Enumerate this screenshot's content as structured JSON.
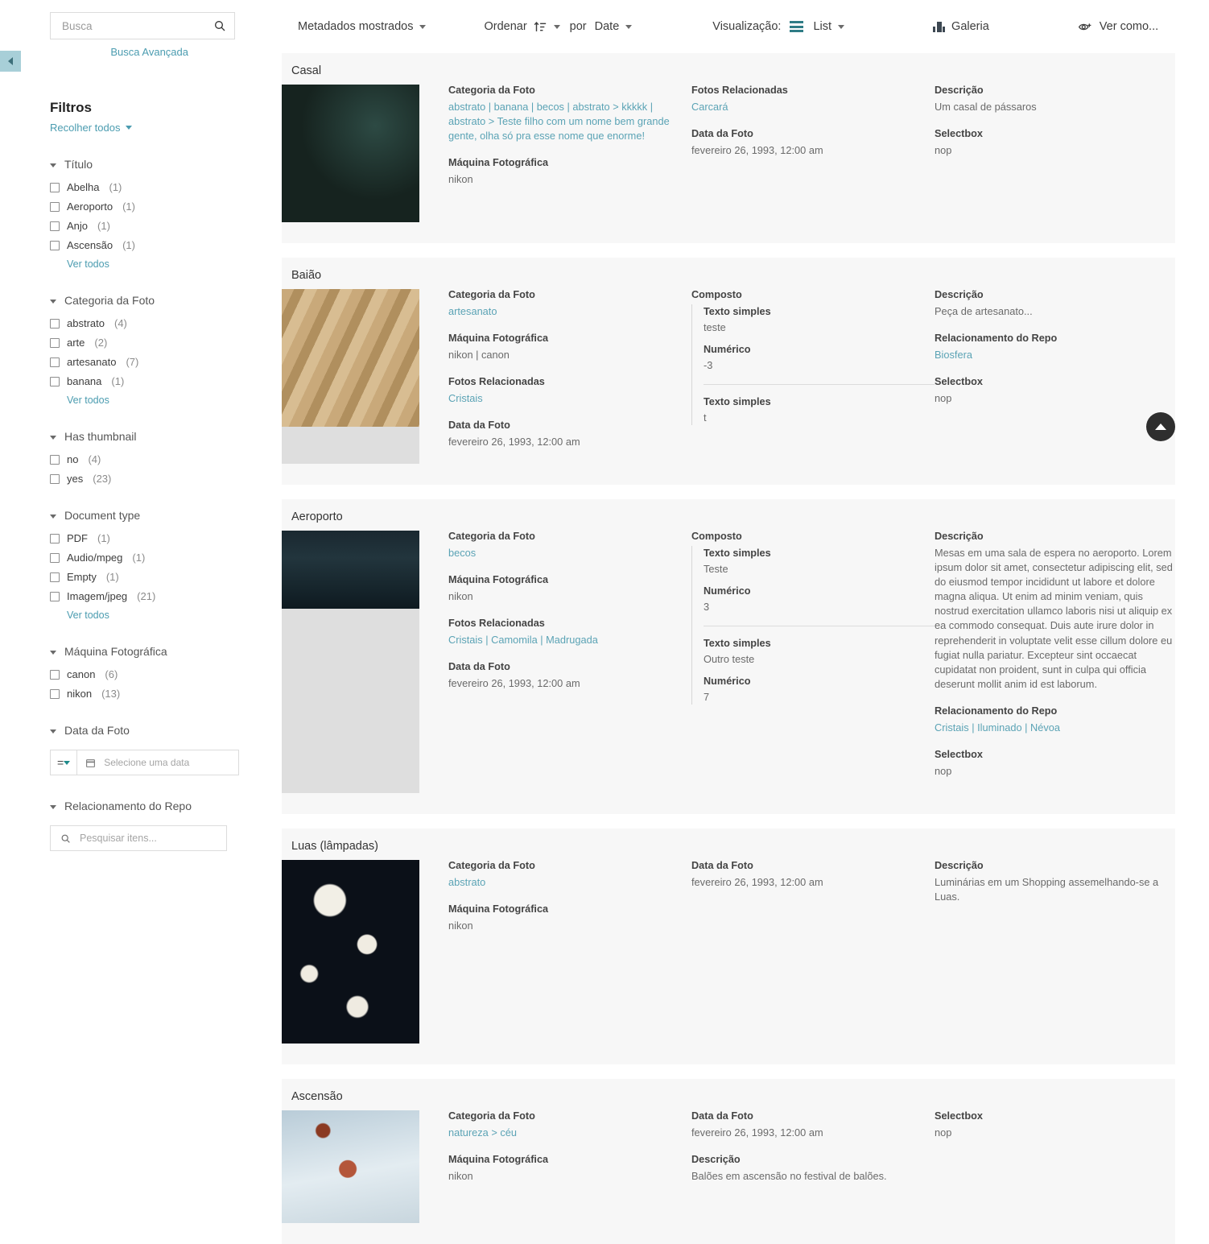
{
  "sidebar": {
    "collapse_handle_icon": "chevron-left-icon",
    "search": {
      "placeholder": "Busca",
      "value": "",
      "icon": "search-icon"
    },
    "advanced_search_label": "Busca Avançada",
    "filters_title": "Filtros",
    "collapse_all_label": "Recolher todos",
    "see_all_label": "Ver todos",
    "facets": [
      {
        "label": "Título",
        "options": [
          {
            "label": "Abelha",
            "count": "(1)"
          },
          {
            "label": "Aeroporto",
            "count": "(1)"
          },
          {
            "label": "Anjo",
            "count": "(1)"
          },
          {
            "label": "Ascensão",
            "count": "(1)"
          }
        ],
        "see_all": true
      },
      {
        "label": "Categoria da Foto",
        "options": [
          {
            "label": "abstrato",
            "count": "(4)"
          },
          {
            "label": "arte",
            "count": "(2)"
          },
          {
            "label": "artesanato",
            "count": "(7)"
          },
          {
            "label": "banana",
            "count": "(1)"
          }
        ],
        "see_all": true
      },
      {
        "label": "Has thumbnail",
        "options": [
          {
            "label": "no",
            "count": "(4)"
          },
          {
            "label": "yes",
            "count": "(23)"
          }
        ],
        "see_all": false
      },
      {
        "label": "Document type",
        "options": [
          {
            "label": "PDF",
            "count": "(1)"
          },
          {
            "label": "Audio/mpeg",
            "count": "(1)"
          },
          {
            "label": "Empty",
            "count": "(1)"
          },
          {
            "label": "Imagem/jpeg",
            "count": "(21)"
          }
        ],
        "see_all": true
      },
      {
        "label": "Máquina Fotográfica",
        "options": [
          {
            "label": "canon",
            "count": "(6)"
          },
          {
            "label": "nikon",
            "count": "(13)"
          }
        ],
        "see_all": false
      }
    ],
    "date_facet": {
      "label": "Data da Foto",
      "operator": "=",
      "date_placeholder": "Selecione uma data",
      "date_value": "",
      "calendar_icon": "calendar-icon"
    },
    "repo_facet": {
      "label": "Relacionamento do Repo",
      "placeholder": "Pesquisar itens...",
      "value": "",
      "icon": "search-icon"
    }
  },
  "toolbar": {
    "metadata_label": "Metadados mostrados",
    "sort_label": "Ordenar",
    "sort_icon": "sort-ascending-icon",
    "by_label": "por",
    "sort_field": "Date",
    "view_label": "Visualização:",
    "view_icon": "list-view-icon",
    "view_mode": "List",
    "gallery_label": "Galeria",
    "gallery_icon": "gallery-icon",
    "view_as_label": "Ver como...",
    "view_as_icon": "eye-plus-icon"
  },
  "scroll_top_icon": "arrow-up-icon",
  "colors": {
    "link": "#5ba3b5",
    "accent_teal": "#1f8a8a",
    "card_bg": "#f7f7f7",
    "handle": "#a8cfd8"
  },
  "cards": [
    {
      "title": "Casal",
      "thumb": "bird-nest-photo",
      "thumb_height": 171,
      "col_a": [
        {
          "type": "text",
          "label": "Categoria da Foto",
          "value": "abstrato | banana | becos | abstrato > kkkkk | abstrato > Teste filho com um nome bem grande gente, olha só pra esse nome que enorme!",
          "link": true
        },
        {
          "type": "text",
          "label": "Máquina Fotográfica",
          "value": "nikon",
          "link": false
        }
      ],
      "col_b": [
        {
          "type": "text",
          "label": "Fotos Relacionadas",
          "value": "Carcará",
          "link": true
        },
        {
          "type": "text",
          "label": "Data da Foto",
          "value": "fevereiro 26, 1993, 12:00 am",
          "link": false
        }
      ],
      "col_c": [
        {
          "type": "text",
          "label": "Descrição",
          "value": "Um casal de pássaros",
          "link": false
        },
        {
          "type": "text",
          "label": "Selectbox",
          "value": "nop",
          "link": false
        }
      ]
    },
    {
      "title": "Baião",
      "thumb": "clay-figurines-photo",
      "thumb_height": 171,
      "col_a": [
        {
          "type": "text",
          "label": "Categoria da Foto",
          "value": "artesanato",
          "link": true
        },
        {
          "type": "text",
          "label": "Máquina Fotográfica",
          "value": "nikon | canon",
          "link": false
        },
        {
          "type": "text",
          "label": "Fotos Relacionadas",
          "value": "Cristais",
          "link": true
        },
        {
          "type": "text",
          "label": "Data da Foto",
          "value": "fevereiro 26, 1993, 12:00 am",
          "link": false
        }
      ],
      "col_b": [
        {
          "type": "composite",
          "label": "Composto",
          "groups": [
            [
              {
                "label": "Texto simples",
                "value": "teste"
              },
              {
                "label": "Numérico",
                "value": "-3"
              }
            ],
            [
              {
                "label": "Texto simples",
                "value": "t"
              }
            ]
          ]
        }
      ],
      "col_c": [
        {
          "type": "text",
          "label": "Descrição",
          "value": "Peça de artesanato...",
          "link": false
        },
        {
          "type": "text",
          "label": "Relacionamento do Repo",
          "value": "Biosfera",
          "link": true
        },
        {
          "type": "text",
          "label": "Selectbox",
          "value": "nop",
          "link": false
        }
      ]
    },
    {
      "title": "Aeroporto",
      "thumb": "airport-lounge-photo",
      "thumb_height": 97,
      "col_a": [
        {
          "type": "text",
          "label": "Categoria da Foto",
          "value": "becos",
          "link": true
        },
        {
          "type": "text",
          "label": "Máquina Fotográfica",
          "value": "nikon",
          "link": false
        },
        {
          "type": "text",
          "label": "Fotos Relacionadas",
          "value": "Cristais | Camomila | Madrugada",
          "link": true
        },
        {
          "type": "text",
          "label": "Data da Foto",
          "value": "fevereiro 26, 1993, 12:00 am",
          "link": false
        }
      ],
      "col_b": [
        {
          "type": "composite",
          "label": "Composto",
          "groups": [
            [
              {
                "label": "Texto simples",
                "value": "Teste"
              },
              {
                "label": "Numérico",
                "value": "3"
              }
            ],
            [
              {
                "label": "Texto simples",
                "value": "Outro teste"
              },
              {
                "label": "Numérico",
                "value": "7"
              }
            ]
          ]
        }
      ],
      "col_c": [
        {
          "type": "text",
          "label": "Descrição",
          "value": "Mesas em uma sala de espera no aeroporto. Lorem ipsum dolor sit amet, consectetur adipiscing elit, sed do eiusmod tempor incididunt ut labore et dolore magna aliqua. Ut enim ad minim veniam, quis nostrud exercitation ullamco laboris nisi ut aliquip ex ea commodo consequat. Duis aute irure dolor in reprehenderit in voluptate velit esse cillum dolore eu fugiat nulla pariatur. Excepteur sint occaecat cupidatat non proident, sunt in culpa qui officia deserunt mollit anim id est laborum.",
          "link": false
        },
        {
          "type": "text",
          "label": "Relacionamento do Repo",
          "value": "Cristais | Iluminado | Névoa",
          "link": true
        },
        {
          "type": "text",
          "label": "Selectbox",
          "value": "nop",
          "link": false
        }
      ]
    },
    {
      "title": "Luas (lâmpadas)",
      "thumb": "moon-lamps-photo",
      "thumb_height": 228,
      "col_a": [
        {
          "type": "text",
          "label": "Categoria da Foto",
          "value": "abstrato",
          "link": true
        },
        {
          "type": "text",
          "label": "Máquina Fotográfica",
          "value": "nikon",
          "link": false
        }
      ],
      "col_b": [
        {
          "type": "text",
          "label": "Data da Foto",
          "value": "fevereiro 26, 1993, 12:00 am",
          "link": false
        }
      ],
      "col_c": [
        {
          "type": "text",
          "label": "Descrição",
          "value": "Luminárias em um Shopping assemelhando-se a Luas.",
          "link": false
        }
      ]
    },
    {
      "title": "Ascensão",
      "thumb": "balloons-sky-photo",
      "thumb_height": 140,
      "col_a": [
        {
          "type": "text",
          "label": "Categoria da Foto",
          "value": "natureza > céu",
          "link": true
        },
        {
          "type": "text",
          "label": "Máquina Fotográfica",
          "value": "nikon",
          "link": false
        }
      ],
      "col_b": [
        {
          "type": "text",
          "label": "Data da Foto",
          "value": "fevereiro 26, 1993, 12:00 am",
          "link": false
        },
        {
          "type": "text",
          "label": "Descrição",
          "value": "Balões em ascensão no festival de balões.",
          "link": false
        }
      ],
      "col_c": [
        {
          "type": "text",
          "label": "Selectbox",
          "value": "nop",
          "link": false
        }
      ]
    }
  ]
}
